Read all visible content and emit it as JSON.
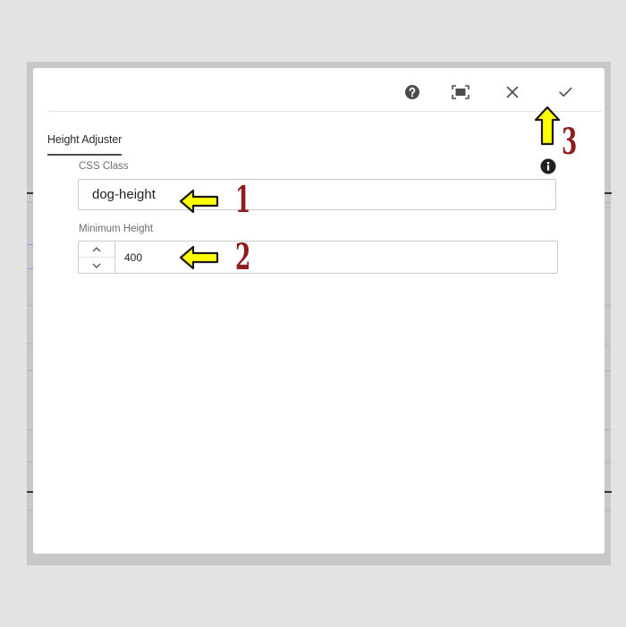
{
  "dialog": {
    "toolbar": {
      "help_icon": "help-circle-icon",
      "fullscreen_icon": "fullscreen-icon",
      "close_icon": "close-icon",
      "confirm_icon": "checkmark-icon"
    },
    "tab": {
      "label": "Height Adjuster"
    },
    "css_class": {
      "label": "CSS Class",
      "value": "dog-height",
      "info_icon": "info-icon"
    },
    "min_height": {
      "label": "Minimum Height",
      "value": "400"
    }
  },
  "annotations": [
    {
      "number": "1",
      "arrow": "left-arrow",
      "color": "#ffff00"
    },
    {
      "number": "2",
      "arrow": "left-arrow",
      "color": "#ffff00"
    },
    {
      "number": "3",
      "arrow": "up-arrow",
      "color": "#ffff00"
    }
  ],
  "colors": {
    "annotation_number": "#8e1d1d",
    "arrow_fill": "#ffff00",
    "dialog_bg": "#ffffff"
  }
}
